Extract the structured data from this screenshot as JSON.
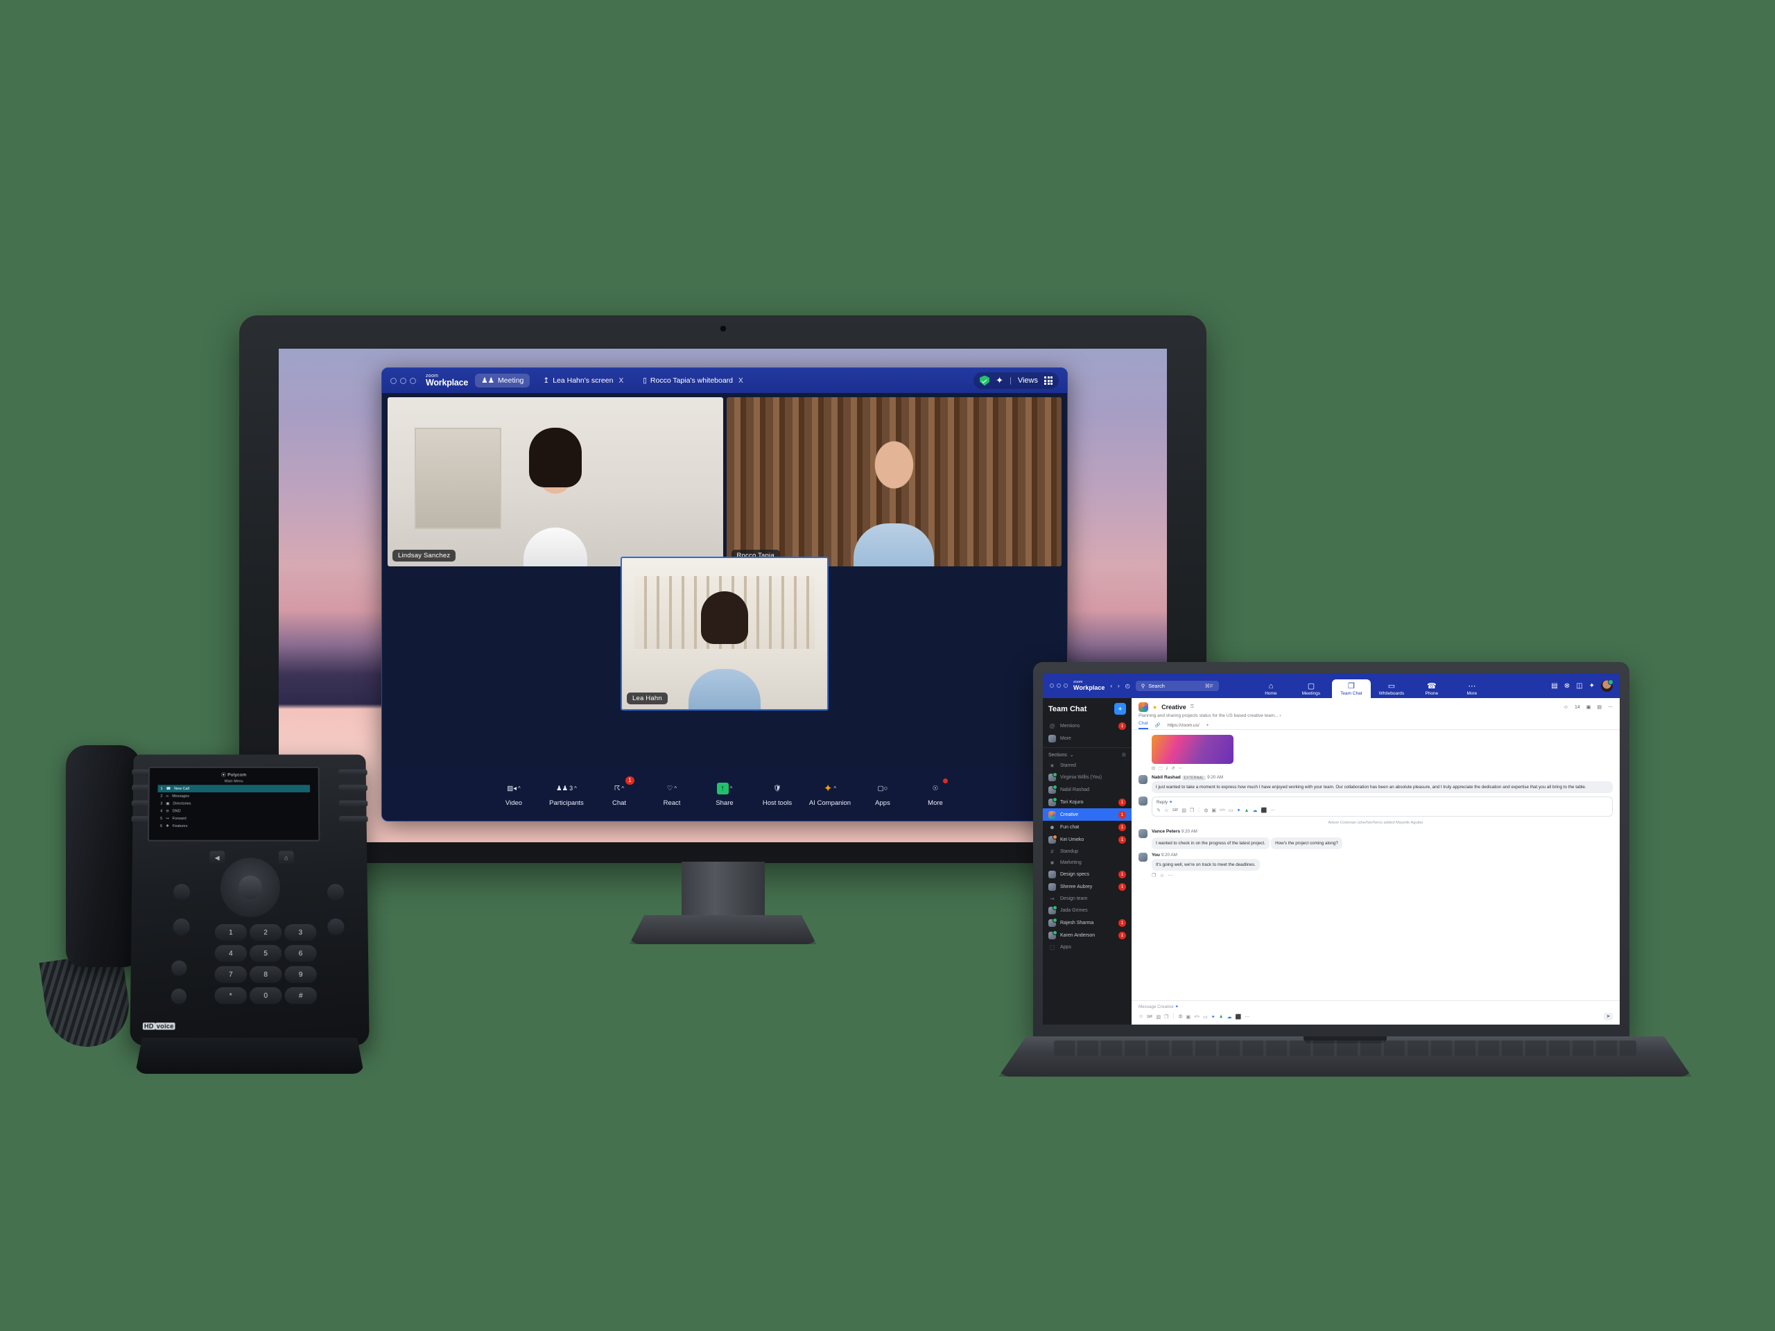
{
  "meeting_window": {
    "app_name_line1": "zoom",
    "app_name_line2": "Workplace",
    "tabs": [
      {
        "label": "Meeting",
        "icon": "people-icon",
        "active": true,
        "closable": false
      },
      {
        "label": "Lea Hahn's screen",
        "icon": "screen-share-icon",
        "active": false,
        "closable": true
      },
      {
        "label": "Rocco Tapia's whiteboard",
        "icon": "whiteboard-icon",
        "active": false,
        "closable": true
      }
    ],
    "close_glyph": "X",
    "views_label": "Views",
    "participants": [
      {
        "name": "Lindsay Sanchez"
      },
      {
        "name": "Rocco Tapia"
      },
      {
        "name": "Lea Hahn"
      }
    ],
    "toolbar": [
      {
        "label": "Video",
        "icon": "video-camera-icon",
        "caret": "^",
        "badge": "",
        "dot": false
      },
      {
        "label": "Participants",
        "icon": "participants-icon",
        "caret": "^",
        "badge": "3",
        "dot": false
      },
      {
        "label": "Chat",
        "icon": "chat-bubble-icon",
        "caret": "^",
        "badge": "1",
        "dot": false
      },
      {
        "label": "React",
        "icon": "heart-icon",
        "caret": "^",
        "badge": "",
        "dot": false
      },
      {
        "label": "Share",
        "icon": "share-screen-icon",
        "caret": "^",
        "badge": "",
        "dot": false
      },
      {
        "label": "Host tools",
        "icon": "shield-icon",
        "caret": "",
        "badge": "",
        "dot": false
      },
      {
        "label": "AI Companion",
        "icon": "sparkle-icon",
        "caret": "^",
        "badge": "",
        "dot": false
      },
      {
        "label": "Apps",
        "icon": "apps-icon",
        "caret": "",
        "badge": "",
        "dot": false
      },
      {
        "label": "More",
        "icon": "more-dots-icon",
        "caret": "",
        "badge": "",
        "dot": true
      }
    ]
  },
  "laptop": {
    "topbar": {
      "app_name_line1": "zoom",
      "app_name_line2": "Workplace",
      "back_glyph": "‹",
      "forward_glyph": "›",
      "history_glyph": "◴",
      "search_placeholder": "Search",
      "search_shortcut": "⌘F",
      "nav_tabs": [
        {
          "label": "Home",
          "icon": "home-icon",
          "glyph": "⌂",
          "active": false
        },
        {
          "label": "Meetings",
          "icon": "calendar-icon",
          "glyph": "▢",
          "active": false
        },
        {
          "label": "Team Chat",
          "icon": "chat-icon",
          "glyph": "❐",
          "active": true
        },
        {
          "label": "Whiteboards",
          "icon": "whiteboard-icon",
          "glyph": "▭",
          "active": false
        },
        {
          "label": "Phone",
          "icon": "phone-icon",
          "glyph": "☎",
          "active": false
        },
        {
          "label": "More",
          "icon": "more-dots-icon",
          "glyph": "⋯",
          "active": false
        }
      ],
      "right_icons": [
        {
          "name": "clipboard-icon",
          "glyph": "▤"
        },
        {
          "name": "bell-icon",
          "glyph": "⊗"
        },
        {
          "name": "panel-toggle-icon",
          "glyph": "◫"
        },
        {
          "name": "sparkle-icon",
          "glyph": "✦"
        }
      ]
    },
    "sidebar": {
      "title": "Team Chat",
      "add_glyph": "+",
      "top_items": [
        {
          "label": "Mentions",
          "icon": "at-icon",
          "glyph": "@",
          "badge": "1",
          "dim": true
        },
        {
          "label": "More",
          "icon": "more-avatar-icon",
          "glyph": "",
          "badge": "",
          "dim": true
        }
      ],
      "sections_label": "Sections",
      "sections_caret": "⌄",
      "filter_glyph": "☰",
      "items": [
        {
          "label": "Starred",
          "type": "glyph",
          "glyph": "★",
          "badge": "",
          "dim": true,
          "selected": false,
          "status": ""
        },
        {
          "label": "Virginia Willis (You)",
          "type": "avatar",
          "glyph": "",
          "badge": "",
          "dim": true,
          "selected": false,
          "status": "on"
        },
        {
          "label": "Nabil Rashad",
          "type": "avatar",
          "glyph": "",
          "badge": "",
          "dim": true,
          "selected": false,
          "status": "on"
        },
        {
          "label": "Tori Kojuro",
          "type": "avatar",
          "glyph": "",
          "badge": "1",
          "dim": false,
          "selected": false,
          "status": "on"
        },
        {
          "label": "Creative",
          "type": "avatar",
          "glyph": "",
          "badge": "1",
          "dim": false,
          "selected": true,
          "status": ""
        },
        {
          "label": "Fun chat",
          "type": "glyph",
          "glyph": "☻",
          "badge": "1",
          "dim": false,
          "selected": false,
          "status": ""
        },
        {
          "label": "Kei Umeko",
          "type": "avatar",
          "glyph": "",
          "badge": "1",
          "dim": false,
          "selected": false,
          "status": "away"
        },
        {
          "label": "Standup",
          "type": "glyph",
          "glyph": "#",
          "badge": "",
          "dim": true,
          "selected": false,
          "status": ""
        },
        {
          "label": "Marketing",
          "type": "glyph",
          "glyph": "■",
          "badge": "",
          "dim": true,
          "selected": false,
          "status": ""
        },
        {
          "label": "Design specs",
          "type": "avatar",
          "glyph": "",
          "badge": "1",
          "dim": false,
          "selected": false,
          "status": ""
        },
        {
          "label": "Sheree Aubrey",
          "type": "avatar",
          "glyph": "",
          "badge": "1",
          "dim": false,
          "selected": false,
          "status": ""
        },
        {
          "label": "Design team",
          "type": "glyph",
          "glyph": "⇝",
          "badge": "",
          "dim": true,
          "selected": false,
          "status": ""
        },
        {
          "label": "Jada Grimes",
          "type": "avatar",
          "glyph": "",
          "badge": "",
          "dim": true,
          "selected": false,
          "status": "on"
        },
        {
          "label": "Rajesh Sharma",
          "type": "avatar",
          "glyph": "",
          "badge": "1",
          "dim": false,
          "selected": false,
          "status": "on"
        },
        {
          "label": "Karen Anderson",
          "type": "avatar",
          "glyph": "",
          "badge": "1",
          "dim": false,
          "selected": false,
          "status": "on"
        },
        {
          "label": "Apps",
          "type": "glyph",
          "glyph": "⬚",
          "badge": "",
          "dim": true,
          "selected": false,
          "status": ""
        }
      ]
    },
    "channel": {
      "star_glyph": "★",
      "name": "Creative",
      "lock_glyph": "⚿",
      "description": "Planning and sharing projects status for the US based creative team... ›",
      "member_count": "14",
      "tabs": [
        {
          "label": "Chat",
          "active": true
        },
        {
          "label": "https://zoom.us/",
          "active": false
        }
      ],
      "add_tab_glyph": "+",
      "header_icons": [
        {
          "name": "members-icon",
          "glyph": "⛟"
        },
        {
          "name": "video-icon",
          "glyph": "▣"
        },
        {
          "name": "clipboard-icon",
          "glyph": "▤"
        },
        {
          "name": "more-dots-icon",
          "glyph": "⋯"
        }
      ]
    },
    "messages": [
      {
        "type": "image",
        "tools": [
          "⊡",
          "⬚",
          "⤓",
          "↺",
          "⋯"
        ]
      },
      {
        "type": "message",
        "author": "Nabil Rashad",
        "tag": "EXTERNAL",
        "time": "9:20 AM",
        "text": "I just wanted to take a moment to express how much I have enjoyed working with your team. Our collaboration has been an absolute pleasure, and I truly appreciate the dedication and expertise that you all bring to the table."
      },
      {
        "type": "reply",
        "label": "Reply",
        "sparkle": "✦",
        "tools": [
          "✎",
          "☺",
          "GIF",
          "▧",
          "❐",
          "│",
          "ф",
          "▣",
          "</>",
          "▭",
          "✦",
          "▲",
          "☁",
          "⬛",
          "⋯"
        ]
      },
      {
        "type": "system",
        "text": "Alison Coleman (she/her/hers) added Mayelle Aguilar"
      },
      {
        "type": "message",
        "author": "Vance Peters",
        "tag": "",
        "time": "9:20 AM",
        "text": "I wanted to check in on the progress of the latest project."
      },
      {
        "type": "bubble",
        "text": "How's the project coming along?"
      },
      {
        "type": "message",
        "author": "You",
        "tag": "",
        "time": "9:20 AM",
        "text": "It's going well, we're on track to meet the deadlines.",
        "reactions": [
          "❐",
          "☺",
          "⋯"
        ]
      }
    ],
    "composer": {
      "placeholder": "Message Creative",
      "sparkle": "✦",
      "tools": [
        "☺",
        "GIF",
        "▧",
        "❐",
        "│",
        "ф",
        "▣",
        "</>",
        "▭",
        "✦",
        "▲",
        "☁",
        "⬛",
        "⋯"
      ],
      "send_glyph": "➤"
    }
  },
  "desk_phone": {
    "brand": "Polycom",
    "screen_title": "Main Menu",
    "menu_items": [
      {
        "num": "1",
        "label": "New Call",
        "icon": "phone-handset-icon",
        "glyph": "☎",
        "selected": true
      },
      {
        "num": "2",
        "label": "Messages",
        "icon": "voicemail-icon",
        "glyph": "∞",
        "selected": false
      },
      {
        "num": "3",
        "label": "Directories",
        "icon": "contacts-icon",
        "glyph": "▣",
        "selected": false
      },
      {
        "num": "4",
        "label": "DND",
        "icon": "dnd-icon",
        "glyph": "⊖",
        "selected": false
      },
      {
        "num": "5",
        "label": "Forward",
        "icon": "forward-icon",
        "glyph": "↪",
        "selected": false
      },
      {
        "num": "6",
        "label": "Features",
        "icon": "features-icon",
        "glyph": "❖",
        "selected": false
      }
    ],
    "hd_label": "HD",
    "hd_voice": "voice",
    "keypad": [
      "1",
      "2",
      "3",
      "4",
      "5",
      "6",
      "7",
      "8",
      "9",
      "*",
      "0",
      "#"
    ],
    "nav_back_glyph": "◀",
    "nav_home_glyph": "⌂"
  },
  "colors": {
    "background": "#45714f",
    "zoom_blue": "#1f35a8",
    "accent_blue": "#2d6ef5",
    "badge_red": "#e02b20",
    "status_green": "#25c16b",
    "share_green": "#21c16b",
    "ai_orange": "#f0a500",
    "phone_sel": "#14626e"
  }
}
